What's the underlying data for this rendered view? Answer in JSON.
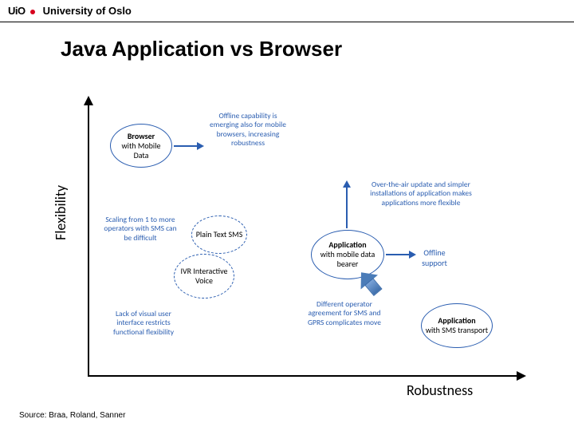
{
  "header": {
    "logo_abbrev": "UiO",
    "logo_full": "University of Oslo"
  },
  "title": "Java Application vs Browser",
  "axes": {
    "y": "Flexibility",
    "x": "Robustness"
  },
  "bubbles": {
    "browser": {
      "bold": "Browser",
      "rest": "with Mobile Data"
    },
    "plain_sms": {
      "text": "Plain Text SMS"
    },
    "ivr": {
      "text": "IVR Interactive Voice"
    },
    "app_mobile": {
      "bold": "Application",
      "rest": "with mobile data bearer"
    },
    "app_sms": {
      "bold": "Application",
      "rest": "with SMS transport"
    }
  },
  "annotations": {
    "offline_browser": "Offline capability is emerging also for mobile browsers, increasing robustness",
    "scaling_sms": "Scaling from 1 to more operators with SMS can be difficult",
    "ivr_limit": "Lack of visual user interface restricts functional flexibility",
    "ota_update": "Over-the-air update and simpler installations of application makes applications more flexible",
    "offline_support": "Offline support",
    "operator_diff": "Different operator agreement for SMS and GPRS complicates move"
  },
  "source": "Source: Braa, Roland, Sanner",
  "chart_data": {
    "type": "scatter",
    "title": "Java Application vs Browser",
    "xlabel": "Robustness",
    "ylabel": "Flexibility",
    "xlim": [
      0,
      10
    ],
    "ylim": [
      0,
      10
    ],
    "series": [
      {
        "name": "Browser with Mobile Data",
        "x": 1.5,
        "y": 8.5
      },
      {
        "name": "Plain Text SMS",
        "x": 3.4,
        "y": 4.5
      },
      {
        "name": "IVR Interactive Voice",
        "x": 3.0,
        "y": 3.0
      },
      {
        "name": "Application with mobile data bearer",
        "x": 6.2,
        "y": 4.2
      },
      {
        "name": "Application with SMS transport",
        "x": 8.6,
        "y": 2.2
      }
    ],
    "transitions": [
      {
        "from": "Browser with Mobile Data",
        "direction": "right",
        "label": "Offline capability is emerging also for mobile browsers, increasing robustness"
      },
      {
        "from": "Application with mobile data bearer",
        "direction": "up",
        "label": "Over-the-air update and simpler installations of application makes applications more flexible"
      },
      {
        "from": "Application with mobile data bearer",
        "direction": "right",
        "label": "Offline support"
      },
      {
        "from": "Application with SMS transport",
        "to": "Application with mobile data bearer",
        "label": "Different operator agreement for SMS and GPRS complicates move"
      }
    ]
  }
}
